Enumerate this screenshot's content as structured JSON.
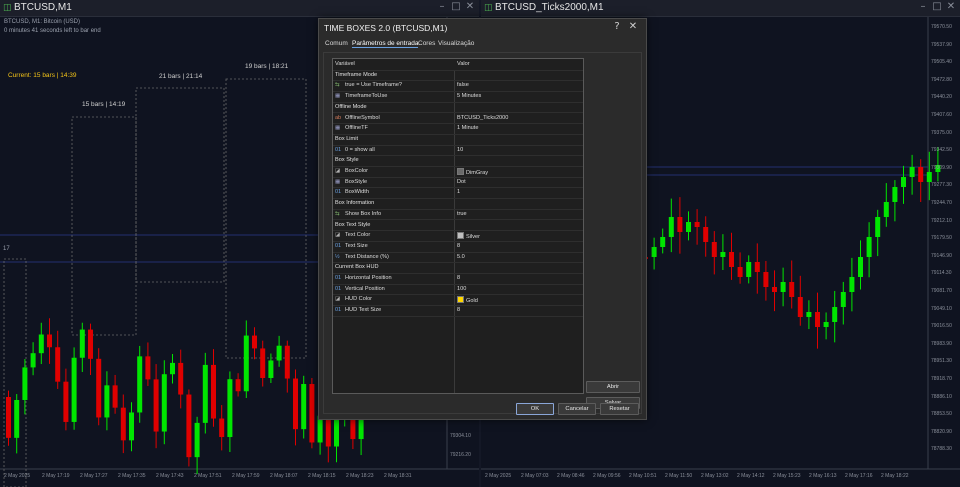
{
  "left_window": {
    "title": "BTCUSD,M1",
    "symbol_info": "BTCUSD, M1: Bitcoin (USD)",
    "timer_text": "0 minutes 41 seconds left to bar end",
    "hud_text": "Current: 15 bars | 14:39",
    "box_labels": [
      "15 bars | 14:19",
      "21 bars | 21:14",
      "19 bars | 18:21"
    ],
    "left_price_label": "17",
    "price_labels": [
      "79304.10",
      "79216.20"
    ],
    "time_labels": [
      "2 May 2025",
      "2 May 17:19",
      "2 May 17:27",
      "2 May 17:35",
      "2 May 17:43",
      "2 May 17:51",
      "2 May 17:59",
      "2 May 18:07",
      "2 May 18:15",
      "2 May 18:23",
      "2 May 18:31"
    ]
  },
  "right_window": {
    "title": "BTCUSD_Ticks2000,M1",
    "price_labels": [
      "79570.50",
      "79537.90",
      "79505.40",
      "79472.80",
      "79440.20",
      "79407.60",
      "79375.00",
      "79342.50",
      "79309.90",
      "79277.30",
      "79244.70",
      "79212.10",
      "79179.50",
      "79146.90",
      "79114.30",
      "79081.70",
      "79049.10",
      "79016.50",
      "78983.90",
      "78951.30",
      "78918.70",
      "78886.10",
      "78853.50",
      "78820.90",
      "78788.30"
    ],
    "time_labels": [
      "2 May 2025",
      "2 May 07:03",
      "2 May 08:46",
      "2 May 09:56",
      "2 May 10:51",
      "2 May 11:50",
      "2 May 13:02",
      "2 May 14:12",
      "2 May 15:23",
      "2 May 16:13",
      "2 May 17:16",
      "2 May 18:22"
    ]
  },
  "dialog": {
    "title": "TIME BOXES 2.0 (BTCUSD,M1)",
    "tabs": [
      "Comum",
      "Parâmetros de entrada",
      "Cores",
      "Visualização"
    ],
    "active_tab": "Parâmetros de entrada",
    "headers": {
      "variable": "Variável",
      "value": "Valor"
    },
    "rows": [
      {
        "type": "group",
        "label": "Timeframe Mode",
        "value": ""
      },
      {
        "type": "param",
        "icon": "bool-icon",
        "label": "true = Use Timeframe?",
        "value": "false"
      },
      {
        "type": "param",
        "icon": "enum-icon",
        "label": "TimeframeToUse",
        "value": "5 Minutes"
      },
      {
        "type": "group",
        "label": "Offline Mode",
        "value": ""
      },
      {
        "type": "param",
        "icon": "string-icon",
        "label": "OfflineSymbol",
        "value": "BTCUSD_Ticks2000"
      },
      {
        "type": "param",
        "icon": "enum-icon",
        "label": "OfflineTF",
        "value": "1 Minute"
      },
      {
        "type": "group",
        "label": "Box Limit",
        "value": ""
      },
      {
        "type": "param",
        "icon": "int-icon",
        "label": "0 = show all",
        "value": "10"
      },
      {
        "type": "group",
        "label": "Box Style",
        "value": ""
      },
      {
        "type": "param",
        "icon": "color-icon",
        "label": "BoxColor",
        "value": "DimGray",
        "swatch": "#696969"
      },
      {
        "type": "param",
        "icon": "enum-icon",
        "label": "BoxStyle",
        "value": "Dot"
      },
      {
        "type": "param",
        "icon": "int-icon",
        "label": "BoxWidth",
        "value": "1"
      },
      {
        "type": "group",
        "label": "Box Information",
        "value": ""
      },
      {
        "type": "param",
        "icon": "bool-icon",
        "label": "Show Box Info",
        "value": "true"
      },
      {
        "type": "group",
        "label": "Box Text Style",
        "value": ""
      },
      {
        "type": "param",
        "icon": "color-icon",
        "label": "Text Color",
        "value": "Silver",
        "swatch": "#c0c0c0"
      },
      {
        "type": "param",
        "icon": "int-icon",
        "label": "Text Size",
        "value": "8"
      },
      {
        "type": "param",
        "icon": "double-icon",
        "label": "Text Distance (%)",
        "value": "5.0"
      },
      {
        "type": "group",
        "label": "Current Box HUD",
        "value": ""
      },
      {
        "type": "param",
        "icon": "int-icon",
        "label": "Horizontal Position",
        "value": "8"
      },
      {
        "type": "param",
        "icon": "int-icon",
        "label": "Vertical Position",
        "value": "100"
      },
      {
        "type": "param",
        "icon": "color-icon",
        "label": "HUD Color",
        "value": "Gold",
        "swatch": "#ffd700"
      },
      {
        "type": "param",
        "icon": "int-icon",
        "label": "HUD Text Size",
        "value": "8"
      }
    ],
    "side_buttons": {
      "load": "Abrir",
      "save": "Salvar"
    },
    "footer_buttons": {
      "ok": "OK",
      "cancel": "Cancelar",
      "reset": "Resetar"
    }
  },
  "colors": {
    "bull": "#00e600",
    "bear": "#e00000",
    "hud": "#f5c518",
    "box_border": "#696969",
    "background": "#0f1320"
  }
}
